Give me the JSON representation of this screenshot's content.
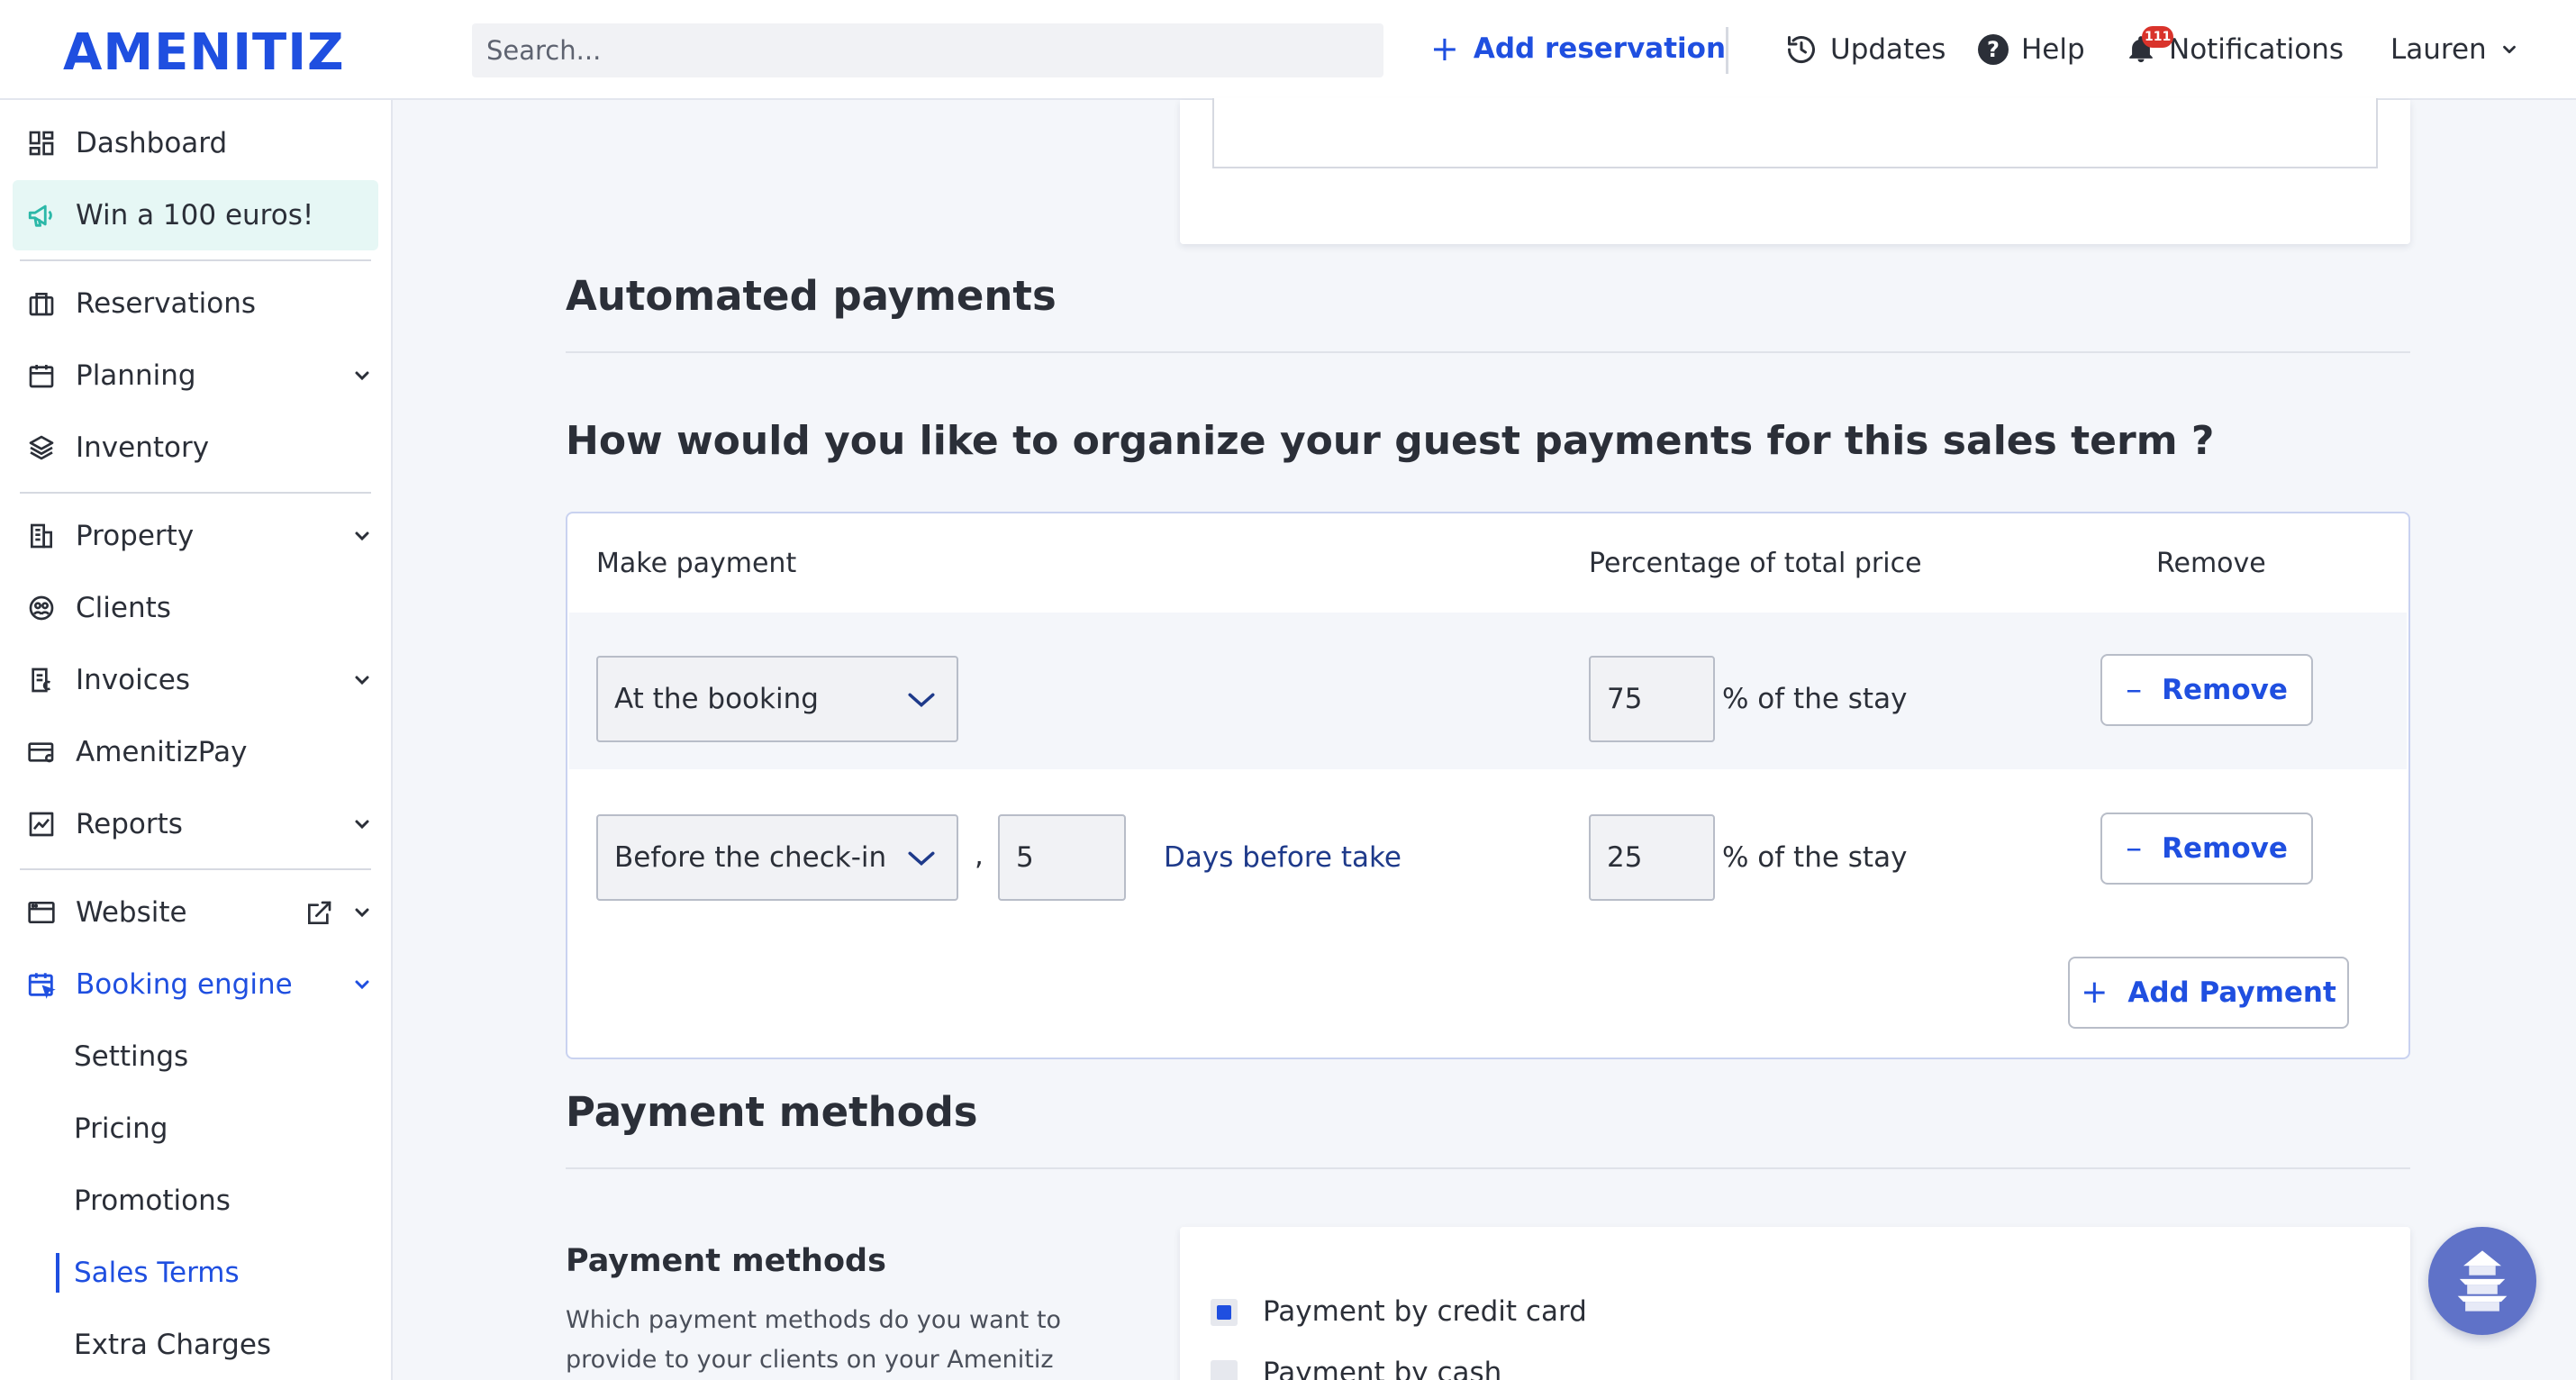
{
  "app": {
    "brand": "AMENITIZ",
    "brand_color": "#1f4fe0"
  },
  "header": {
    "search_placeholder": "Search...",
    "add_reservation": "Add reservation",
    "updates": "Updates",
    "help": "Help",
    "notifications": "Notifications",
    "notification_count": "111",
    "user": "Lauren"
  },
  "sidebar": {
    "items": [
      {
        "label": "Dashboard",
        "icon": "dashboard-icon"
      },
      {
        "label": "Win a 100 euros!",
        "icon": "megaphone-icon"
      },
      {
        "label": "Reservations",
        "icon": "briefcase-icon"
      },
      {
        "label": "Planning",
        "icon": "calendar-icon"
      },
      {
        "label": "Inventory",
        "icon": "layers-icon"
      },
      {
        "label": "Property",
        "icon": "building-icon"
      },
      {
        "label": "Clients",
        "icon": "clients-icon"
      },
      {
        "label": "Invoices",
        "icon": "invoice-icon"
      },
      {
        "label": "AmenitizPay",
        "icon": "card-icon"
      },
      {
        "label": "Reports",
        "icon": "chart-icon"
      },
      {
        "label": "Website",
        "icon": "browser-icon"
      },
      {
        "label": "Booking engine",
        "icon": "booking-engine-icon"
      }
    ],
    "sub_items": [
      "Settings",
      "Pricing",
      "Promotions",
      "Sales Terms",
      "Extra Charges"
    ],
    "active_sub": "Sales Terms"
  },
  "main": {
    "automated_title": "Automated payments",
    "question": "How would you like to organize your guest payments for this sales term ?",
    "table": {
      "headers": {
        "make_payment": "Make payment",
        "percentage": "Percentage of total price",
        "remove": "Remove"
      },
      "rows": [
        {
          "when": "At the booking",
          "percent": "75",
          "suffix": "% of the stay",
          "remove": "Remove"
        },
        {
          "when": "Before the check-in",
          "separator": ",",
          "days": "5",
          "days_label": "Days before take",
          "percent": "25",
          "suffix": "% of the stay",
          "remove": "Remove"
        }
      ],
      "add_payment": "Add Payment"
    },
    "payment_methods_title": "Payment methods",
    "pm": {
      "title": "Payment methods",
      "description": "Which payment methods do you want to provide to your clients on your Amenitiz",
      "options": [
        {
          "label": "Payment by credit card",
          "checked": true
        },
        {
          "label": "Payment by cash",
          "checked": false
        }
      ]
    }
  }
}
